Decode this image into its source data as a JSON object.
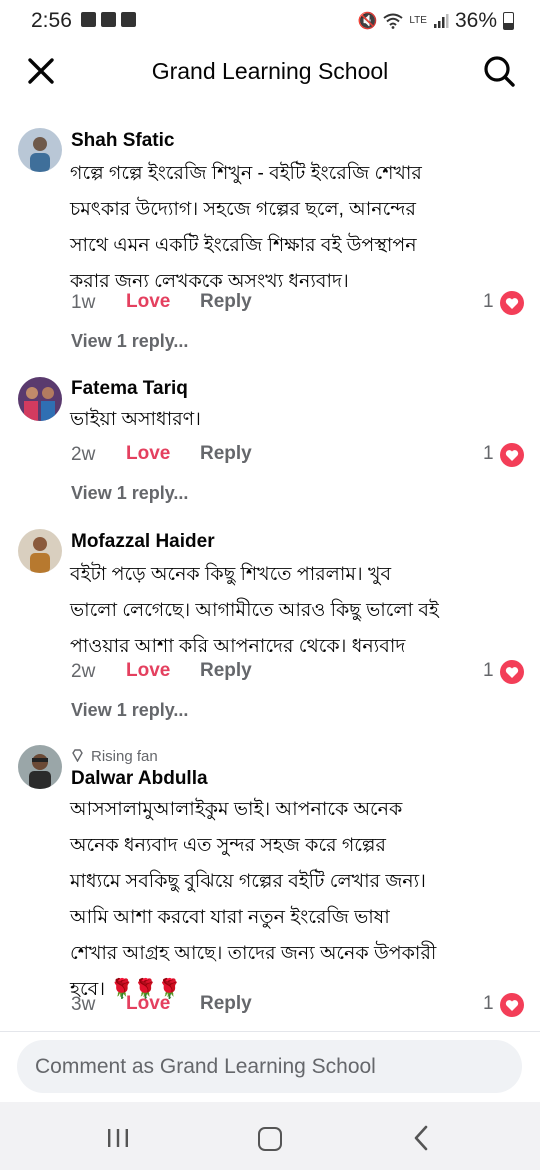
{
  "status_bar": {
    "time": "2:56",
    "battery": "36%",
    "network": "LTE"
  },
  "header": {
    "title": "Grand Learning School"
  },
  "comments": [
    {
      "name": "Shah Sfatic",
      "badge": "",
      "text": "গল্পে গল্পে ইংরেজি শিখুন - বইটি ইংরেজি শেখার\nচমৎকার উদ্যোগ। সহজে গল্পের ছলে, আনন্দের\nসাথে এমন একটি ইংরেজি শিক্ষার বই উপস্থাপন\nকরার জন্য লেখককে অসংখ্য ধন্যবাদ।",
      "time": "1w",
      "love": "Love",
      "reply": "Reply",
      "reactions": "1",
      "view_replies": "View 1 reply..."
    },
    {
      "name": "Fatema Tariq",
      "badge": "",
      "text": "ভাইয়া অসাধারণ।",
      "time": "2w",
      "love": "Love",
      "reply": "Reply",
      "reactions": "1",
      "view_replies": "View 1 reply..."
    },
    {
      "name": "Mofazzal Haider",
      "badge": "",
      "text": "বইটা পড়ে অনেক কিছু শিখতে পারলাম। খুব\nভালো লেগেছে। আগামীতে আরও কিছু ভালো বই\nপাওয়ার আশা করি আপনাদের থেকে। ধন্যবাদ",
      "time": "2w",
      "love": "Love",
      "reply": "Reply",
      "reactions": "1",
      "view_replies": "View 1 reply..."
    },
    {
      "name": "Dalwar Abdulla",
      "badge": "Rising fan",
      "text": "আসসালামুআলাইকুম ভাই। আপনাকে অনেক\nঅনেক ধন্যবাদ এত সুন্দর সহজ করে গল্পের\nমাধ্যমে সবকিছু বুঝিয়ে গল্পের বইটি লেখার জন্য।\nআমি আশা করবো যারা নতুন ইংরেজি ভাষা\nশেখার আগ্রহ আছে। তাদের জন্য অনেক উপকারী\nহবে। 🌹🌹🌹",
      "time": "3w",
      "love": "Love",
      "reply": "Reply",
      "reactions": "1",
      "view_replies": ""
    }
  ],
  "composer": {
    "placeholder": "Comment as Grand Learning School"
  },
  "colors": {
    "love": "#e4405f",
    "heart": "#f33e58",
    "secondary_text": "#65676b"
  }
}
